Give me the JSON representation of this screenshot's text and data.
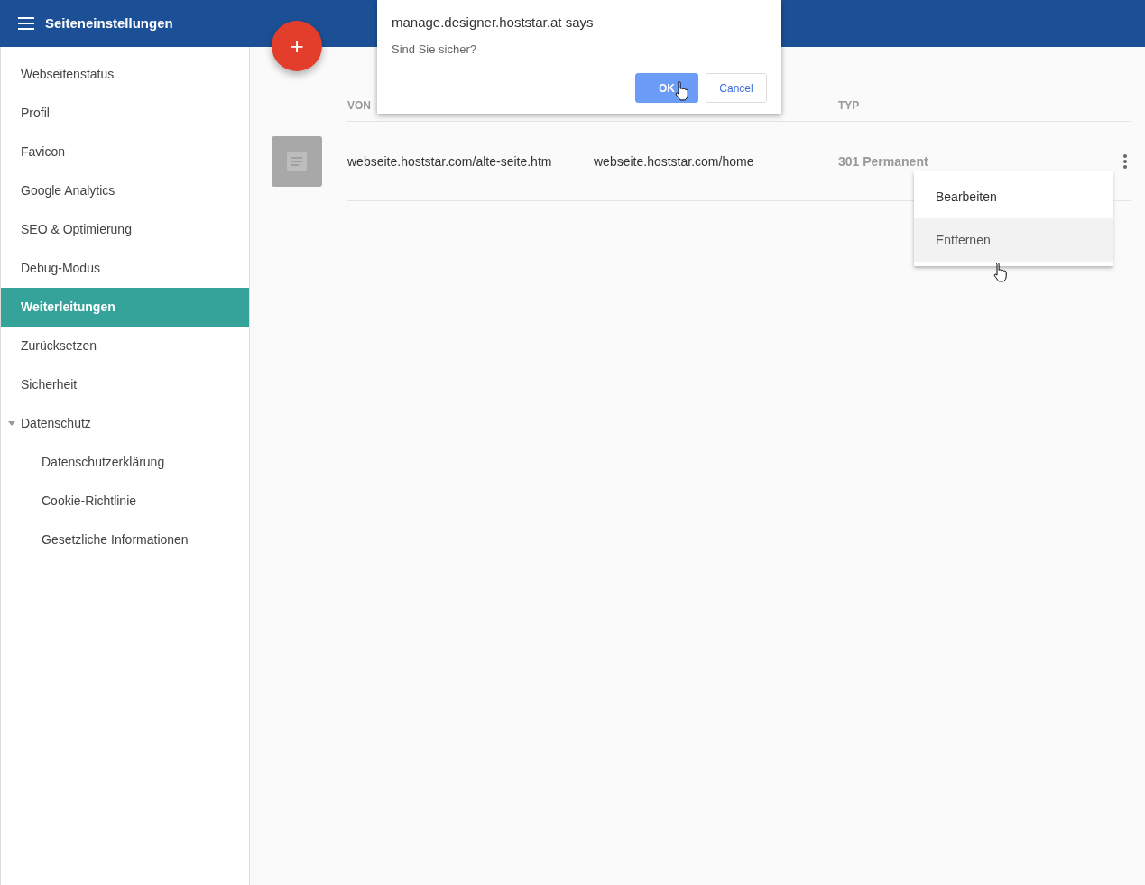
{
  "header": {
    "title": "Seiteneinstellungen"
  },
  "sidebar": {
    "items": [
      {
        "label": "Webseitenstatus",
        "selected": false
      },
      {
        "label": "Profil",
        "selected": false
      },
      {
        "label": "Favicon",
        "selected": false
      },
      {
        "label": "Google Analytics",
        "selected": false
      },
      {
        "label": "SEO & Optimierung",
        "selected": false
      },
      {
        "label": "Debug-Modus",
        "selected": false
      },
      {
        "label": "Weiterleitungen",
        "selected": true
      },
      {
        "label": "Zurücksetzen",
        "selected": false
      },
      {
        "label": "Sicherheit",
        "selected": false
      },
      {
        "label": "Datenschutz",
        "selected": false,
        "expanded": true,
        "children": [
          {
            "label": "Datenschutzerklärung",
            "selected": false
          },
          {
            "label": "Cookie-Richtlinie",
            "selected": false
          },
          {
            "label": "Gesetzliche Informationen",
            "selected": false
          }
        ]
      }
    ]
  },
  "fab": {
    "label": "+"
  },
  "table": {
    "columns": [
      "VON",
      "TYP"
    ],
    "rows": [
      {
        "from": "webseite.hoststar.com/alte-seite.htm",
        "to": "webseite.hoststar.com/home",
        "type": "301 Permanent"
      }
    ]
  },
  "row_menu": {
    "items": [
      {
        "label": "Bearbeiten",
        "selected": false
      },
      {
        "label": "Entfernen",
        "selected": true
      }
    ]
  },
  "dialog": {
    "title": "manage.designer.hoststar.at says",
    "message": "Sind Sie sicher?",
    "buttons": [
      {
        "label": "OK",
        "kind": "primary"
      },
      {
        "label": "Cancel",
        "kind": "secondary"
      }
    ]
  }
}
